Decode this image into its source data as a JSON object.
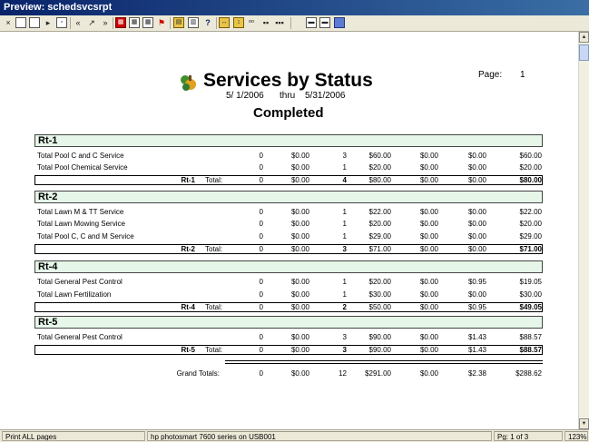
{
  "window": {
    "title": "Preview: schedsvcsrpt"
  },
  "toolbar": {
    "icons": [
      "close-icon",
      "new-page-icon",
      "open-icon",
      "next-icon",
      "fit-icon",
      "first-page-icon",
      "prev-page-icon",
      "last-page-icon",
      "grid1-icon",
      "grid2-icon",
      "calendar-icon",
      "flag-icon",
      "export-icon",
      "chart-icon",
      "help-icon",
      "width-icon",
      "height-icon",
      "search-icon",
      "two-page-icon",
      "multi-page-icon",
      "print-icon",
      "print-setup-icon",
      "exit-door-icon"
    ]
  },
  "report": {
    "title": "Services by Status",
    "page_label": "Page:",
    "page_number": "1",
    "date_from": "5/ 1/2006",
    "thru": "thru",
    "date_to": "5/31/2006",
    "subtitle": "Completed",
    "groups": [
      {
        "name": "Rt-1",
        "rows": [
          {
            "label": "Total Pool C and C Service",
            "c1": "0",
            "c2": "$0.00",
            "c3": "3",
            "c4": "$60.00",
            "c5": "$0.00",
            "c6": "$0.00",
            "c7": "$60.00"
          },
          {
            "label": "Total Pool Chemical Service",
            "c1": "0",
            "c2": "$0.00",
            "c3": "1",
            "c4": "$20.00",
            "c5": "$0.00",
            "c6": "$0.00",
            "c7": "$20.00"
          }
        ],
        "total": {
          "name": "Rt-1",
          "label": "Total:",
          "c1": "0",
          "c2": "$0.00",
          "c3": "4",
          "c4": "$80.00",
          "c5": "$0.00",
          "c6": "$0.00",
          "c7": "$80.00"
        }
      },
      {
        "name": "Rt-2",
        "rows": [
          {
            "label": "Total Lawn M & TT Service",
            "c1": "0",
            "c2": "$0.00",
            "c3": "1",
            "c4": "$22.00",
            "c5": "$0.00",
            "c6": "$0.00",
            "c7": "$22.00"
          },
          {
            "label": "Total Lawn Mowing Service",
            "c1": "0",
            "c2": "$0.00",
            "c3": "1",
            "c4": "$20.00",
            "c5": "$0.00",
            "c6": "$0.00",
            "c7": "$20.00"
          },
          {
            "label": "Total Pool C, C and M Service",
            "c1": "0",
            "c2": "$0.00",
            "c3": "1",
            "c4": "$29.00",
            "c5": "$0.00",
            "c6": "$0.00",
            "c7": "$29.00"
          }
        ],
        "total": {
          "name": "Rt-2",
          "label": "Total:",
          "c1": "0",
          "c2": "$0.00",
          "c3": "3",
          "c4": "$71.00",
          "c5": "$0.00",
          "c6": "$0.00",
          "c7": "$71.00"
        }
      },
      {
        "name": "Rt-4",
        "rows": [
          {
            "label": "Total General Pest Control",
            "c1": "0",
            "c2": "$0.00",
            "c3": "1",
            "c4": "$20.00",
            "c5": "$0.00",
            "c6": "$0.95",
            "c7": "$19.05"
          },
          {
            "label": "Total Lawn Fertilization",
            "c1": "0",
            "c2": "$0.00",
            "c3": "1",
            "c4": "$30.00",
            "c5": "$0.00",
            "c6": "$0.00",
            "c7": "$30.00"
          }
        ],
        "total": {
          "name": "Rt-4",
          "label": "Total:",
          "c1": "0",
          "c2": "$0.00",
          "c3": "2",
          "c4": "$50.00",
          "c5": "$0.00",
          "c6": "$0.95",
          "c7": "$49.05"
        }
      },
      {
        "name": "Rt-5",
        "rows": [
          {
            "label": "Total General Pest Control",
            "c1": "0",
            "c2": "$0.00",
            "c3": "3",
            "c4": "$90.00",
            "c5": "$0.00",
            "c6": "$1.43",
            "c7": "$88.57"
          }
        ],
        "total": {
          "name": "Rt-5",
          "label": "Total:",
          "c1": "0",
          "c2": "$0.00",
          "c3": "3",
          "c4": "$90.00",
          "c5": "$0.00",
          "c6": "$1.43",
          "c7": "$88.57"
        }
      }
    ],
    "grand_totals": {
      "label": "Grand Totals:",
      "c1": "0",
      "c2": "$0.00",
      "c3": "12",
      "c4": "$291.00",
      "c5": "$0.00",
      "c6": "$2.38",
      "c7": "$288.62"
    }
  },
  "statusbar": {
    "mode": "Print ALL pages",
    "printer": "hp photosmart 7600 series on USB001",
    "page_of": "Pg: 1 of 3",
    "zoom": "123%"
  },
  "colors": {
    "group_header_bg": "#e6f6e8",
    "titlebar": "#0a246a"
  }
}
